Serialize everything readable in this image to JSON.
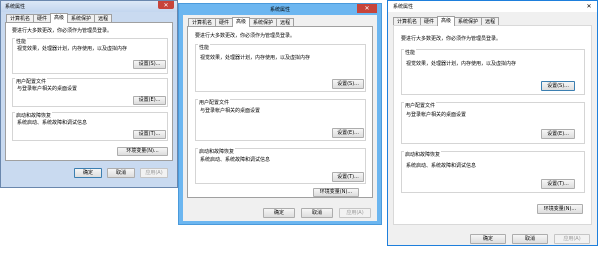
{
  "title": "系统属性",
  "tabs": [
    "计算机名",
    "硬件",
    "高级",
    "系统保护",
    "远程"
  ],
  "notice": "要进行大多数更改，你必须作为管理员登录。",
  "groups": {
    "performance": {
      "label": "性能",
      "desc": "视觉效果，处理器计划，内存使用，以及虚拟内存"
    },
    "profiles": {
      "label": "用户配置文件",
      "desc": "与登录帐户相关的桌面设置"
    },
    "startup": {
      "label": "启动和故障恢复",
      "desc": "系统启动、系统故障和调试信息"
    }
  },
  "buttons": {
    "settings": "设置(S)...",
    "settings_e": "设置(E)...",
    "settings_t": "设置(T)...",
    "env": "环境变量(N)...",
    "ok": "确定",
    "cancel": "取消",
    "apply": "应用(A)"
  },
  "close_glyph": "✕",
  "colors": {
    "win7_titlebar": "#c9daf0",
    "win8_frame": "#6cb6f0",
    "win10_frame": "#1e7fdc",
    "close_red": "#c7443a",
    "button_default_border": "#3c7fb1"
  }
}
